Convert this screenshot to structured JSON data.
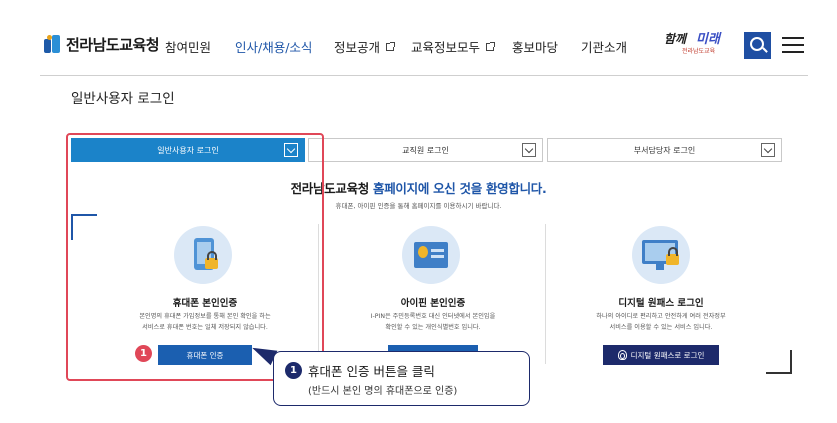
{
  "header": {
    "logo_text": "전라남도교육청",
    "nav": [
      {
        "label": "참여민원"
      },
      {
        "label": "인사/채용/소식"
      },
      {
        "label": "정보공개"
      },
      {
        "label": "교육정보모두"
      },
      {
        "label": "홍보마당"
      },
      {
        "label": "기관소개"
      }
    ],
    "slogan": {
      "line1": "함께",
      "line2": "미래",
      "line3": "전라남도교육"
    }
  },
  "page_title": "일반사용자 로그인",
  "tabs": [
    {
      "label": "일반사용자 로그인"
    },
    {
      "label": "교직원 로그인"
    },
    {
      "label": "부서담당자 로그인"
    }
  ],
  "welcome": {
    "org": "전라남도교육청",
    "highlight": "홈페이지에 오신 것을 환영합니다.",
    "subtitle": "휴대폰, 아이핀 인증을 통해 홈페이지를 이용하시기 바랍니다."
  },
  "cards": [
    {
      "title": "휴대폰 본인인증",
      "desc1": "본인명의 휴대폰 가입정보를 통해 본인 확인을 하는",
      "desc2": "서비스로 휴대폰 번호는 일체 저장되지 않습니다.",
      "button": "휴대폰 인증"
    },
    {
      "title": "아이핀 본인인증",
      "desc1": "I-PIN은 주민등록번호 대신 인터넷에서 본인임을",
      "desc2": "확인할 수 있는 개인식별번호 입니다.",
      "button": ""
    },
    {
      "title": "디지털 원패스 로그인",
      "desc1": "하나의 아이디로 편리하고 안전하게 여러 전자정부",
      "desc2": "서비스를 이용할 수 있는 서비스 입니다.",
      "button": "디지털 원패스로 로그인"
    }
  ],
  "annotation": {
    "step": "1",
    "title": "휴대폰 인증 버튼을 클릭",
    "subtitle": "(반드시 본인 명의 휴대폰으로 인증)"
  },
  "colors": {
    "primary": "#1f56a8",
    "tab_active": "#1b83c9",
    "annotation_red": "#e04758",
    "navy": "#1d2a6b"
  }
}
